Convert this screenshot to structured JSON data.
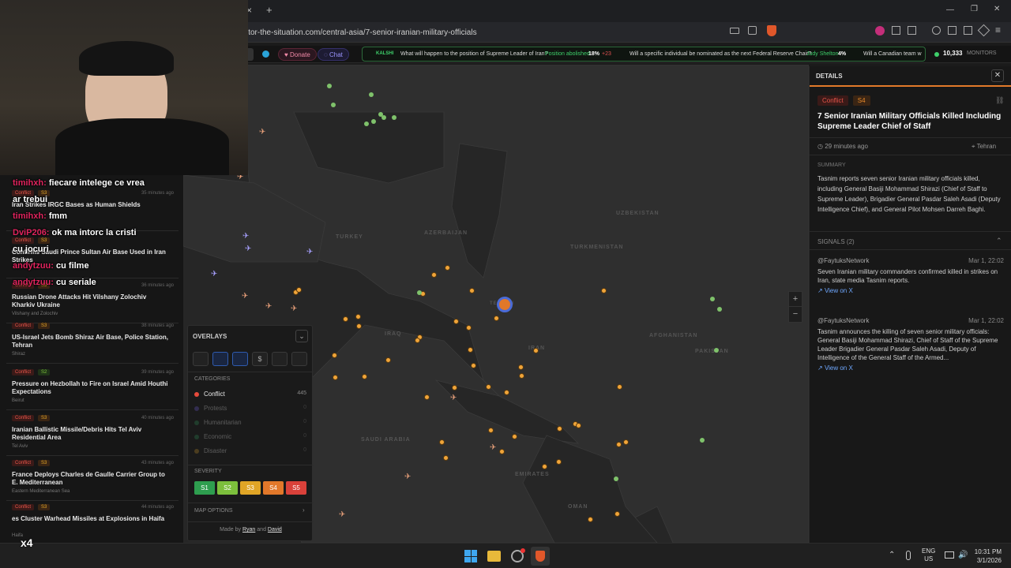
{
  "browser": {
    "url": "itor-the-situation.com/central-asia/7-senior-iranian-military-officials",
    "new_tab": "+",
    "close_tab": "×",
    "win_min": "—",
    "win_max": "❐",
    "win_close": "✕"
  },
  "appbar": {
    "donate": "Donate",
    "chat": "Chat",
    "kalshi": "KALSHI",
    "ticker": [
      {
        "text": "What will happen to the position of Supreme Leader of Iran?",
        "tag": "Position abolished",
        "pct": "18%",
        "delta": "+23"
      },
      {
        "text": "Will a specific individual be nominated as the next Federal Reserve Chair?",
        "tag": "Judy Shelton",
        "pct": "4%",
        "delta": ""
      },
      {
        "text": "Will a Canadian team w",
        "tag": "",
        "pct": "",
        "delta": ""
      }
    ],
    "monitors_count": "10,333",
    "monitors_label": "MONITORS"
  },
  "details": {
    "header": "DETAILS",
    "tag_type": "Conflict",
    "tag_sev": "S4",
    "title": "7 Senior Iranian Military Officials Killed Including Supreme Leader Chief of Staff",
    "time": "29 minutes ago",
    "location": "Tehran",
    "summary_label": "SUMMARY",
    "summary": "Tasnim reports seven senior Iranian military officials killed, including General Basiji Mohammad Shirazi (Chief of Staff to Supreme Leader), Brigadier General Pasdar Saleh Asadi (Deputy Intelligence Chief), and General Pilot Mohsen Darreh Baghi.",
    "signals_label": "SIGNALS (2)",
    "signals": [
      {
        "source": "@FaytuksNetwork",
        "date": "Mar 1, 22:02",
        "text": "Seven Iranian military commanders confirmed killed in strikes on Iran, state media Tasnim reports.",
        "link": "View on X"
      },
      {
        "source": "@FaytuksNetwork",
        "date": "Mar 1, 22:02",
        "text": "Tasnim announces the killing of seven senior military officials: General Basiji Mohammad Shirazi, Chief of Staff of the Supreme Leader Brigadier General Pasdar Saleh Asadi, Deputy of Intelligence of the General Staff of the Armed...",
        "link": "View on X"
      }
    ]
  },
  "feed": [
    {
      "tag": "Conflict",
      "sev": "S3",
      "time": "35 minutes ago",
      "title": "Iran Strikes IRGC Bases as Human Shields",
      "loc": ""
    },
    {
      "tag": "Conflict",
      "sev": "S3",
      "time": "",
      "title": "Confirms Saudi Prince Sultan Air Base Used in Iran Strikes",
      "loc": ""
    },
    {
      "tag": "Conflict",
      "sev": "S3",
      "time": "36 minutes ago",
      "title": "Russian Drone Attacks Hit Vilshany Zolochiv Kharkiv Ukraine",
      "loc": "Vilshany and Zolochiv"
    },
    {
      "tag": "Conflict",
      "sev": "S3",
      "time": "38 minutes ago",
      "title": "US-Israel Jets Bomb Shiraz Air Base, Police Station, Tehran",
      "loc": "Shiraz"
    },
    {
      "tag": "Conflict",
      "sev": "S2",
      "time": "39 minutes ago",
      "title": "Pressure on Hezbollah to Fire on Israel Amid Houthi Expectations",
      "loc": "Beirut"
    },
    {
      "tag": "Conflict",
      "sev": "S3",
      "time": "40 minutes ago",
      "title": "Iranian Ballistic Missile/Debris Hits Tel Aviv Residential Area",
      "loc": "Tel Aviv"
    },
    {
      "tag": "Conflict",
      "sev": "S3",
      "time": "43 minutes ago",
      "title": "France Deploys Charles de Gaulle Carrier Group to E. Mediterranean",
      "loc": "Eastern Mediterranean Sea"
    },
    {
      "tag": "Conflict",
      "sev": "S3",
      "time": "44 minutes ago",
      "title": "es Cluster Warhead Missiles at Explosions in Haifa",
      "loc": "Haifa"
    }
  ],
  "chat": [
    {
      "name": "timihxh:",
      "msg": "fiecare intelege ce vrea"
    },
    {
      "name": "",
      "msg": "ar trebui"
    },
    {
      "name": "timihxh:",
      "msg": "fmm"
    },
    {
      "name": "DviP206:",
      "msg": "ok ma intorc la cristi"
    },
    {
      "name": "",
      "msg": "cu jocuri"
    },
    {
      "name": "andytzuu:",
      "msg": "cu filme"
    },
    {
      "name": "andytzuu:",
      "msg": "cu seriale"
    }
  ],
  "overlays": {
    "header": "OVERLAYS",
    "categories_label": "CATEGORIES",
    "categories": [
      {
        "name": "Conflict",
        "count": "445",
        "color": "#e64a3b",
        "active": true
      },
      {
        "name": "Protests",
        "count": "0",
        "color": "#6a5acd",
        "active": false
      },
      {
        "name": "Humanitarian",
        "count": "0",
        "color": "#2e8b57",
        "active": false
      },
      {
        "name": "Economic",
        "count": "0",
        "color": "#2e8b57",
        "active": false
      },
      {
        "name": "Disaster",
        "count": "0",
        "color": "#c0902b",
        "active": false
      }
    ],
    "severity_label": "SEVERITY",
    "severity": [
      {
        "label": "S1",
        "color": "#2e9e4f"
      },
      {
        "label": "S2",
        "color": "#7cbf3c"
      },
      {
        "label": "S3",
        "color": "#e0a526"
      },
      {
        "label": "S4",
        "color": "#e2782a"
      },
      {
        "label": "S5",
        "color": "#d9413a"
      }
    ],
    "map_options": "MAP OPTIONS",
    "made_by": "Made by",
    "author1": "Ryan",
    "and": "and",
    "author2": "David"
  },
  "map": {
    "labels": [
      "TURKEY",
      "TURKMENISTAN",
      "AZERBAIJAN",
      "UZBEKISTAN",
      "PAKISTAN",
      "AFGHANISTAN",
      "SAUDI ARABIA",
      "IRAQ",
      "IRAN",
      "OMAN",
      "EMIRATES",
      "TEHRAN"
    ],
    "zoom_in": "+",
    "zoom_out": "−"
  },
  "taskbar": {
    "lang1": "ENG",
    "lang2": "US",
    "time": "10:31 PM",
    "date": "3/1/2026"
  },
  "webcam_badge": "x4"
}
